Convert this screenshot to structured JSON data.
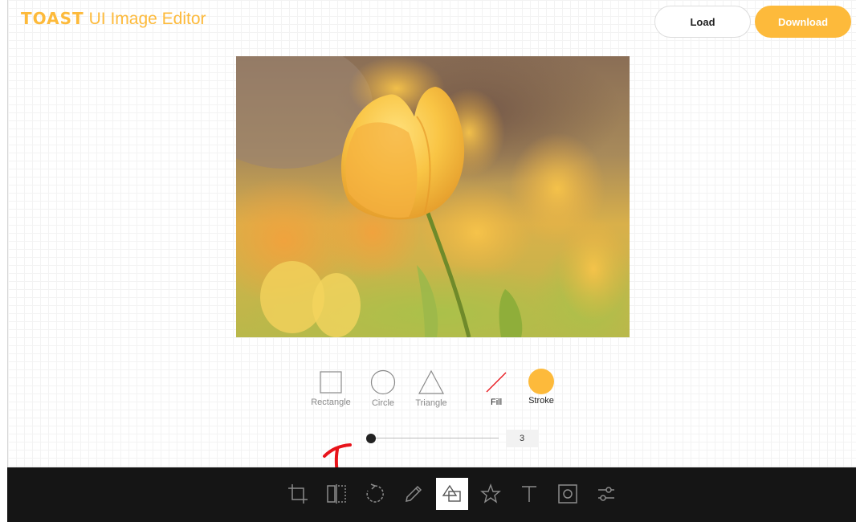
{
  "header": {
    "logo_brand": "TOAST",
    "logo_product": "UI Image Editor",
    "load_label": "Load",
    "download_label": "Download"
  },
  "canvas": {
    "subject": "yellow tulip photo"
  },
  "shape_menu": {
    "shapes": [
      {
        "label": "Rectangle",
        "icon": "rectangle-icon"
      },
      {
        "label": "Circle",
        "icon": "circle-icon"
      },
      {
        "label": "Triangle",
        "icon": "triangle-icon"
      }
    ],
    "fill_label": "Fill",
    "stroke_label": "Stroke",
    "stroke_color": "#fdba3b",
    "fill_color": "transparent",
    "stroke_width_value": "3",
    "stroke_width_fraction": 0
  },
  "toolbar": {
    "tools": [
      {
        "name": "crop-icon",
        "active": false
      },
      {
        "name": "flip-icon",
        "active": false
      },
      {
        "name": "rotate-icon",
        "active": false
      },
      {
        "name": "draw-icon",
        "active": false
      },
      {
        "name": "shape-icon",
        "active": true
      },
      {
        "name": "icon-star-icon",
        "active": false
      },
      {
        "name": "text-icon",
        "active": false
      },
      {
        "name": "mask-icon",
        "active": false
      },
      {
        "name": "filter-icon",
        "active": false
      }
    ]
  },
  "colors": {
    "accent": "#fdba3b",
    "toolbar_bg": "#151515",
    "annotation": "#e8141b"
  }
}
